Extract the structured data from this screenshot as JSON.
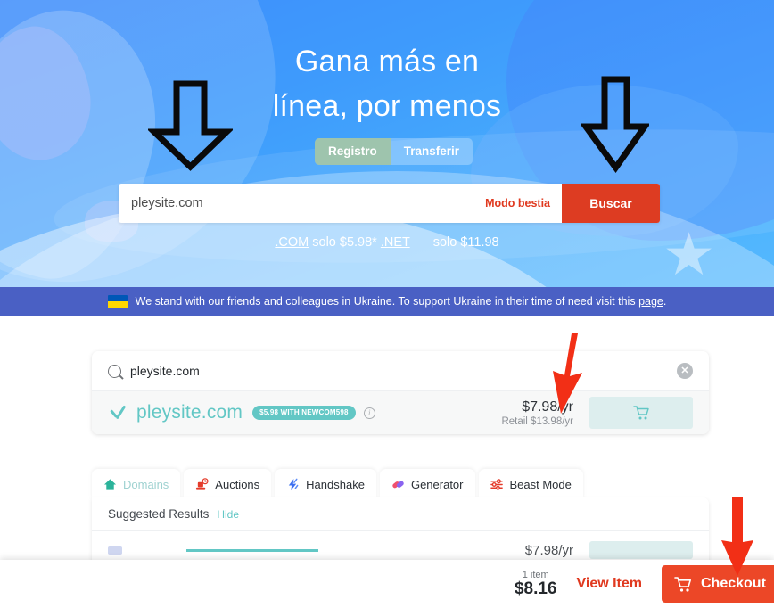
{
  "hero": {
    "title_line1": "Gana más en",
    "title_line2": "línea, por menos",
    "toggle": {
      "register": "Registro",
      "transfer": "Transferir"
    },
    "search": {
      "value": "pleysite.com",
      "placeholder": "pleysite.com",
      "beast_mode_label": "Modo bestia",
      "search_button": "Buscar"
    },
    "tld_line": {
      "com_tld": ".COM",
      "com_price": "solo $5.98*",
      "net_tld": ".NET",
      "net_price": "solo $11.98"
    },
    "colors": {
      "accent_red": "#dd3c22",
      "active_toggle": "#9ec4ad"
    }
  },
  "banner": {
    "flag_icon": "ukraine-flag-icon",
    "text_before": "We stand with our friends and colleagues in Ukraine. To support Ukraine in their time of need visit this ",
    "link": "page",
    "text_after": ".",
    "color": "#4a60c4"
  },
  "results": {
    "search_field": {
      "icon": "search-icon",
      "value": "pleysite.com",
      "clear_icon": "close-icon"
    },
    "row": {
      "check_icon": "check-icon",
      "domain": "pleysite.com",
      "promo_badge": "$5.98 WITH NEWCOM598",
      "info_icon": "info-icon",
      "price": "$7.98/yr",
      "retail": "Retail $13.98/yr",
      "cart_icon": "cart-icon"
    },
    "tabs": [
      {
        "label": "Domains",
        "icon": "home-icon",
        "active": true
      },
      {
        "label": "Auctions",
        "icon": "gavel-icon",
        "active": false
      },
      {
        "label": "Handshake",
        "icon": "lightning-icon",
        "active": false
      },
      {
        "label": "Generator",
        "icon": "capsule-icon",
        "active": false
      },
      {
        "label": "Beast Mode",
        "icon": "sliders-icon",
        "active": false
      }
    ],
    "panel": {
      "heading": "Suggested Results",
      "hide_label": "Hide",
      "ghost_price": "$7.98/yr"
    }
  },
  "checkout_bar": {
    "item_count": "1 item",
    "amount": "$8.16",
    "view_item_label": "View Item",
    "checkout_label": "Checkout",
    "cart_icon": "cart-icon",
    "button_color": "#ec4727"
  },
  "annotations": {
    "arrow_hero_left": "black-down-arrow",
    "arrow_hero_right": "black-down-arrow",
    "arrow_price": "red-down-arrow",
    "arrow_checkout": "red-down-arrow"
  }
}
